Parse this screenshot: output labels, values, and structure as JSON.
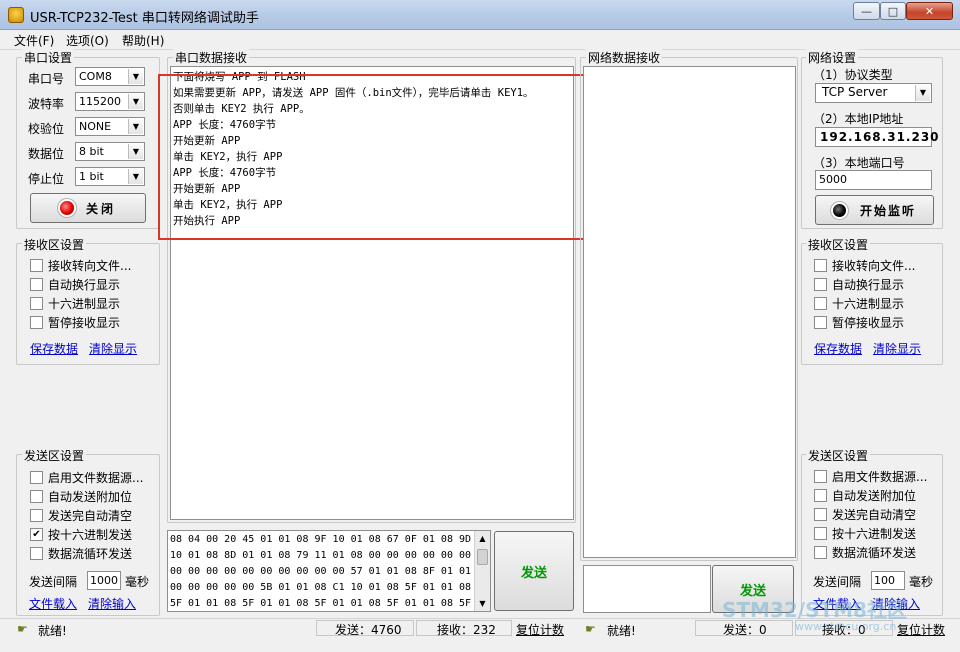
{
  "window": {
    "title": "USR-TCP232-Test 串口转网络调试助手"
  },
  "menu": [
    "文件(F)",
    "选项(O)",
    "帮助(H)"
  ],
  "serial_settings": {
    "title": "串口设置",
    "port_label": "串口号",
    "port_value": "COM8",
    "baud_label": "波特率",
    "baud_value": "115200",
    "parity_label": "校验位",
    "parity_value": "NONE",
    "databits_label": "数据位",
    "databits_value": "8 bit",
    "stopbits_label": "停止位",
    "stopbits_value": "1 bit",
    "close_button": "关闭"
  },
  "serial_rx_settings": {
    "title": "接收区设置",
    "options": [
      {
        "label": "接收转向文件...",
        "checked": false
      },
      {
        "label": "自动换行显示",
        "checked": false
      },
      {
        "label": "十六进制显示",
        "checked": false
      },
      {
        "label": "暂停接收显示",
        "checked": false
      }
    ],
    "save_link": "保存数据",
    "clear_link": "清除显示"
  },
  "serial_tx_settings": {
    "title": "发送区设置",
    "options": [
      {
        "label": "启用文件数据源...",
        "checked": false
      },
      {
        "label": "自动发送附加位",
        "checked": false
      },
      {
        "label": "发送完自动清空",
        "checked": false
      },
      {
        "label": "按十六进制发送",
        "checked": true
      },
      {
        "label": "数据流循环发送",
        "checked": false
      }
    ],
    "interval_label": "发送间隔",
    "interval_value": "1000",
    "interval_unit": "毫秒",
    "load_link": "文件载入",
    "clear_link": "清除输入"
  },
  "serial_rx": {
    "title": "串口数据接收",
    "lines": [
      "下面将烧写 APP 到 FLASH",
      "如果需要更新 APP，请发送 APP 固件（.bin文件），完毕后请单击 KEY1。",
      "否则单击 KEY2 执行 APP。",
      "APP 长度：4760字节",
      "开始更新 APP",
      "单击 KEY2，执行 APP",
      "APP 长度：4760字节",
      "开始更新 APP",
      "单击 KEY2，执行 APP",
      "开始执行 APP"
    ]
  },
  "serial_tx": {
    "hex_lines": [
      "08 04 00 20 45 01 01 08 9F 10 01 08 67 0F 01 08 9D",
      "10 01 08 8D 01 01 08 79 11 01 08 00 00 00 00 00 00",
      "00 00 00 00 00 00 00 00 00 00 57 01 01 08 8F 01 01",
      "00 00 00 00 00 5B 01 01 08 C1 10 01 08 5F 01 01 08",
      "5F 01 01 08 5F 01 01 08 5F 01 01 08 5F 01 01 08 5F"
    ],
    "send_button": "发送"
  },
  "network_rx": {
    "title": "网络数据接收"
  },
  "network_tx": {
    "send_button": "发送"
  },
  "network_settings": {
    "title": "网络设置",
    "protocol_label": "（1）协议类型",
    "protocol_value": "TCP Server",
    "ip_label": "（2）本地IP地址",
    "ip_value": "192.168.31.230",
    "port_label": "（3）本地端口号",
    "port_value": "5000",
    "listen_button": "开始监听"
  },
  "net_rx_settings": {
    "title": "接收区设置",
    "options": [
      {
        "label": "接收转向文件...",
        "checked": false
      },
      {
        "label": "自动换行显示",
        "checked": false
      },
      {
        "label": "十六进制显示",
        "checked": false
      },
      {
        "label": "暂停接收显示",
        "checked": false
      }
    ],
    "save_link": "保存数据",
    "clear_link": "清除显示"
  },
  "net_tx_settings": {
    "title": "发送区设置",
    "options": [
      {
        "label": "启用文件数据源...",
        "checked": false
      },
      {
        "label": "自动发送附加位",
        "checked": false
      },
      {
        "label": "发送完自动清空",
        "checked": false
      },
      {
        "label": "按十六进制发送",
        "checked": false
      },
      {
        "label": "数据流循环发送",
        "checked": false
      }
    ],
    "interval_label": "发送间隔",
    "interval_value": "100",
    "interval_unit": "毫秒",
    "load_link": "文件载入",
    "clear_link": "清除输入"
  },
  "status_left": {
    "ready": "就绪!",
    "sent": "发送：4760",
    "received": "接收：232",
    "reset": "复位计数"
  },
  "status_right": {
    "ready": "就绪!",
    "sent": "发送：0",
    "received": "接收：0",
    "reset": "复位计数"
  },
  "watermark": {
    "line1": "STM32/STM8社区",
    "line2": "www.stmcu.org.cn"
  },
  "colors": {
    "highlight_border": "#d9362b",
    "send_text": "#009900",
    "link": "#0000cc"
  },
  "icons": [
    "app-icon",
    "minimize-icon",
    "maximize-icon",
    "close-icon",
    "status-icon"
  ]
}
